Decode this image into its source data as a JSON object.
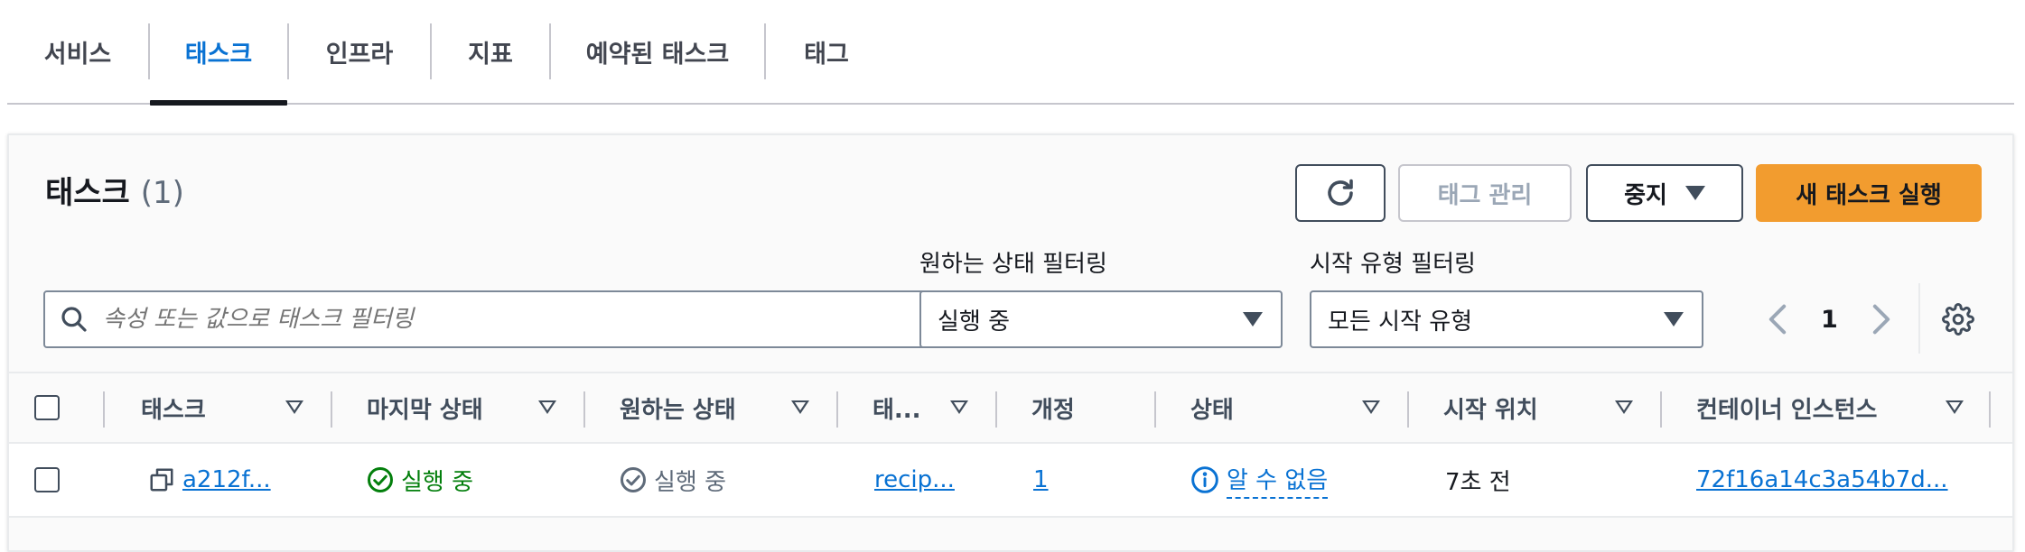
{
  "tabs": [
    {
      "label": "서비스"
    },
    {
      "label": "태스크"
    },
    {
      "label": "인프라"
    },
    {
      "label": "지표"
    },
    {
      "label": "예약된 태스크"
    },
    {
      "label": "태그"
    }
  ],
  "panel": {
    "title": "태스크",
    "count": "(1)"
  },
  "actions": {
    "manage_tags": "태그 관리",
    "stop": "중지",
    "run_new_task": "새 태스크 실행"
  },
  "filters": {
    "search_placeholder": "속성 또는 값으로 태스크 필터링",
    "desired_status_label": "원하는 상태 필터링",
    "desired_status_value": "실행 중",
    "launch_type_label": "시작 유형 필터링",
    "launch_type_value": "모든 시작 유형"
  },
  "pagination": {
    "current_page": "1"
  },
  "table": {
    "headers": {
      "task": "태스크",
      "last_status": "마지막 상태",
      "desired_status": "원하는 상태",
      "task_definition": "태...",
      "revision": "개정",
      "health": "상태",
      "started": "시작 위치",
      "container_instance": "컨테이너 인스턴스"
    },
    "rows": [
      {
        "task": "a212f...",
        "last_status": "실행 중",
        "desired_status": "실행 중",
        "task_definition": "recip...",
        "revision": "1",
        "health": "알 수 없음",
        "started": "7초 전",
        "container_instance": "72f16a14c3a54b7d..."
      }
    ]
  },
  "colors": {
    "link": "#0972d3",
    "primary_button": "#f29c2f",
    "success": "#037f0c",
    "active_tab_underline": "#16191f"
  }
}
